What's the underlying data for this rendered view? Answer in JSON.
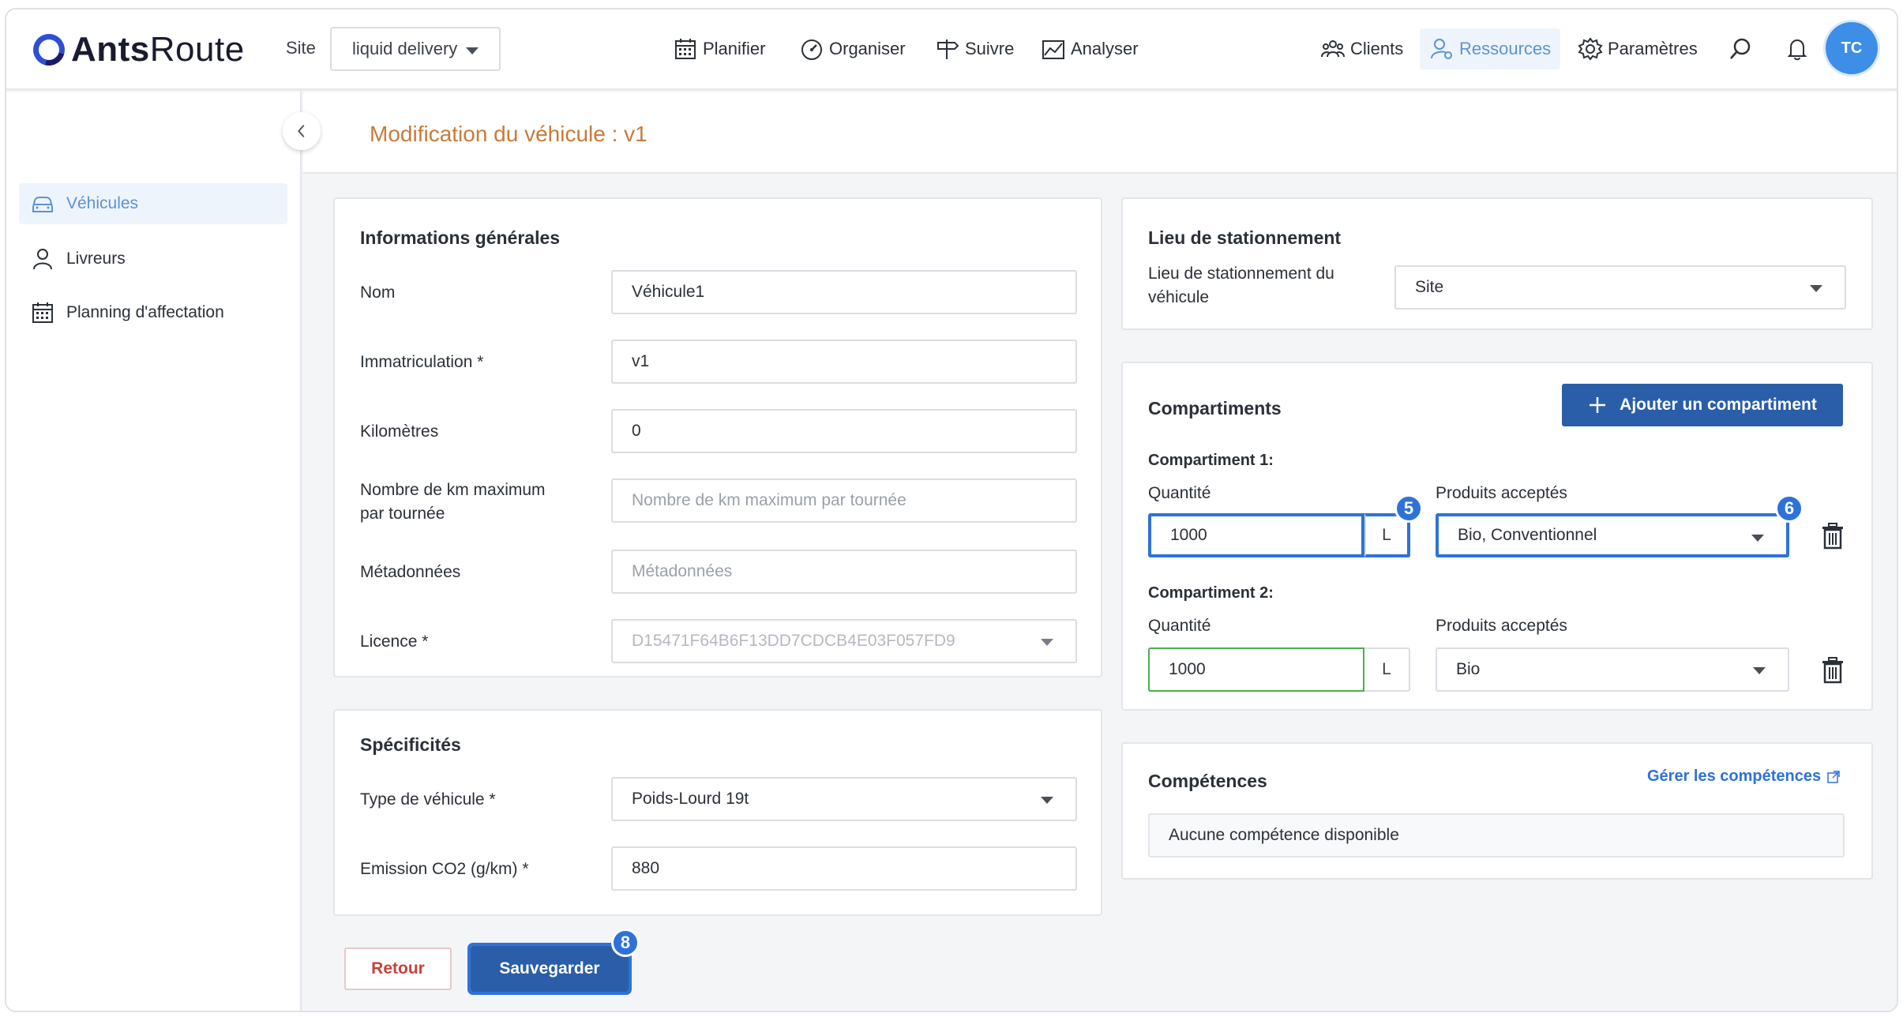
{
  "header": {
    "logo_bold": "Ants",
    "logo_light": "Route",
    "site_label": "Site",
    "site_value": "liquid delivery",
    "nav": {
      "planifier": "Planifier",
      "organiser": "Organiser",
      "suivre": "Suivre",
      "analyser": "Analyser",
      "clients": "Clients",
      "ressources": "Ressources",
      "parametres": "Paramètres"
    },
    "avatar_initials": "TC"
  },
  "sidebar": {
    "items": [
      {
        "label": "Véhicules",
        "icon": "car-icon",
        "active": true
      },
      {
        "label": "Livreurs",
        "icon": "person-icon",
        "active": false
      },
      {
        "label": "Planning d'affectation",
        "icon": "calendar-icon",
        "active": false
      }
    ]
  },
  "page": {
    "title": "Modification du véhicule : v1"
  },
  "general": {
    "title": "Informations générales",
    "nom_label": "Nom",
    "nom_value": "Véhicule1",
    "immat_label": "Immatriculation *",
    "immat_value": "v1",
    "km_label": "Kilomètres",
    "km_value": "0",
    "maxkm_label_1": "Nombre de km maximum",
    "maxkm_label_2": "par tournée",
    "maxkm_placeholder": "Nombre de km maximum par tournée",
    "meta_label": "Métadonnées",
    "meta_placeholder": "Métadonnées",
    "licence_label": "Licence *",
    "licence_value": "D15471F64B6F13DD7CDCB4E03F057FD9"
  },
  "specs": {
    "title": "Spécificités",
    "type_label": "Type de véhicule *",
    "type_value": "Poids-Lourd 19t",
    "co2_label": "Emission CO2 (g/km) *",
    "co2_value": "880"
  },
  "parking": {
    "title": "Lieu de stationnement",
    "label_1": "Lieu de stationnement du",
    "label_2": "véhicule",
    "value": "Site"
  },
  "compartments": {
    "title": "Compartiments",
    "add_button": "Ajouter un compartiment",
    "items": [
      {
        "heading": "Compartiment 1:",
        "qty_label": "Quantité",
        "qty_value": "1000",
        "unit": "L",
        "products_label": "Produits acceptés",
        "products_value": "Bio, Conventionnel",
        "qty_badge": "5",
        "products_badge": "6"
      },
      {
        "heading": "Compartiment 2:",
        "qty_label": "Quantité",
        "qty_value": "1000",
        "unit": "L",
        "products_label": "Produits acceptés",
        "products_value": "Bio"
      }
    ]
  },
  "skills": {
    "title": "Compétences",
    "manage_link": "Gérer les compétences",
    "empty": "Aucune compétence disponible"
  },
  "footer": {
    "back": "Retour",
    "save": "Sauvegarder",
    "save_badge": "8"
  }
}
